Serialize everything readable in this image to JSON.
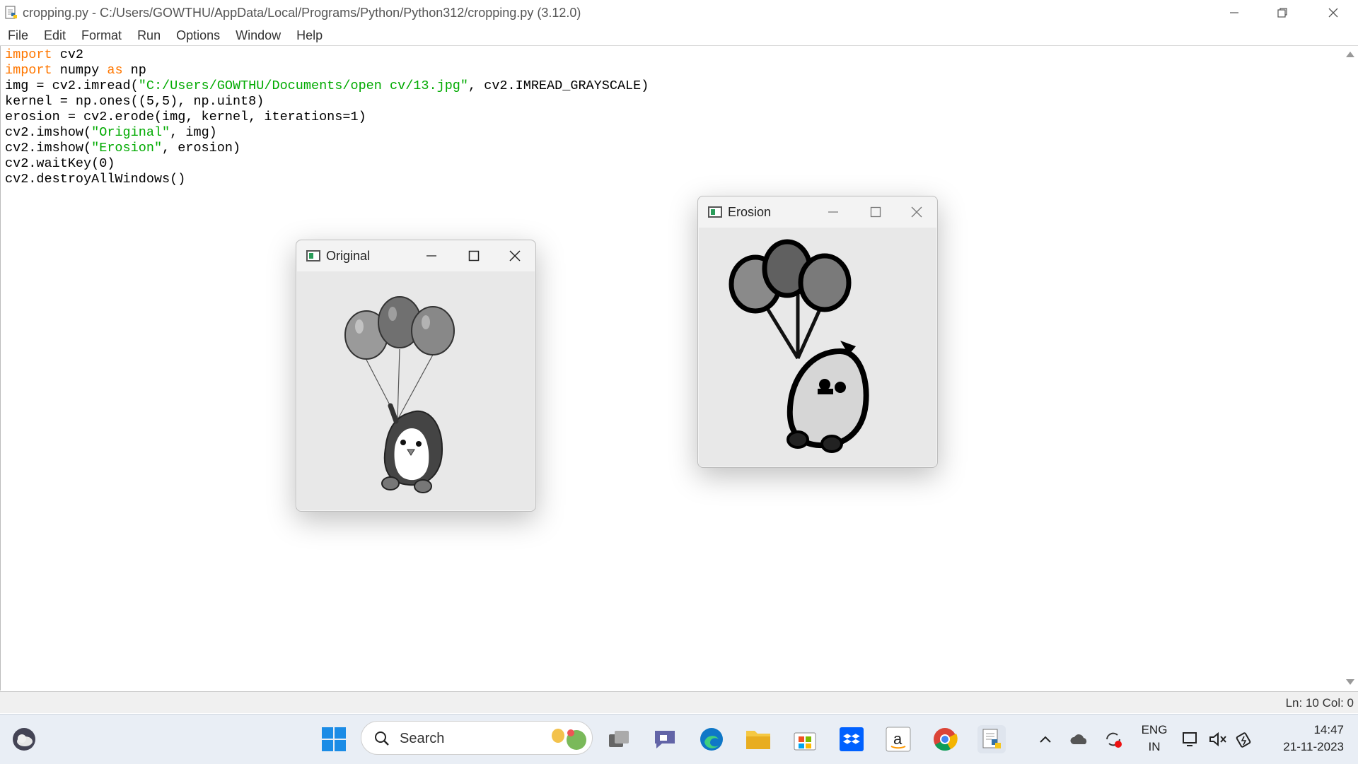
{
  "window": {
    "title": "cropping.py - C:/Users/GOWTHU/AppData/Local/Programs/Python/Python312/cropping.py (3.12.0)"
  },
  "menu": [
    "File",
    "Edit",
    "Format",
    "Run",
    "Options",
    "Window",
    "Help"
  ],
  "code": {
    "lines": [
      [
        {
          "t": "import",
          "c": "kw"
        },
        {
          "t": " cv2"
        }
      ],
      [
        {
          "t": "import",
          "c": "kw"
        },
        {
          "t": " numpy "
        },
        {
          "t": "as",
          "c": "kw"
        },
        {
          "t": " np"
        }
      ],
      [
        {
          "t": "img = cv2.imread("
        },
        {
          "t": "\"C:/Users/GOWTHU/Documents/open cv/13.jpg\"",
          "c": "str"
        },
        {
          "t": ", cv2.IMREAD_GRAYSCALE)"
        }
      ],
      [
        {
          "t": "kernel = np.ones((5,5), np.uint8)"
        }
      ],
      [
        {
          "t": "erosion = cv2.erode(img, kernel, iterations=1)"
        }
      ],
      [
        {
          "t": "cv2.imshow("
        },
        {
          "t": "\"Original\"",
          "c": "str"
        },
        {
          "t": ", img)"
        }
      ],
      [
        {
          "t": "cv2.imshow("
        },
        {
          "t": "\"Erosion\"",
          "c": "str"
        },
        {
          "t": ", erosion)"
        }
      ],
      [
        {
          "t": "cv2.waitKey(0)"
        }
      ],
      [
        {
          "t": "cv2.destroyAllWindows()"
        }
      ]
    ]
  },
  "status": {
    "text": "Ln: 10  Col: 0"
  },
  "cv_windows": {
    "original": {
      "title": "Original"
    },
    "erosion": {
      "title": "Erosion"
    }
  },
  "taskbar": {
    "search_label": "Search",
    "lang_line1": "ENG",
    "lang_line2": "IN",
    "time": "14:47",
    "date": "21-11-2023"
  },
  "colors": {
    "keyword": "#ff7700",
    "string": "#00aa00",
    "taskbar_bg": "#e9eef5"
  }
}
